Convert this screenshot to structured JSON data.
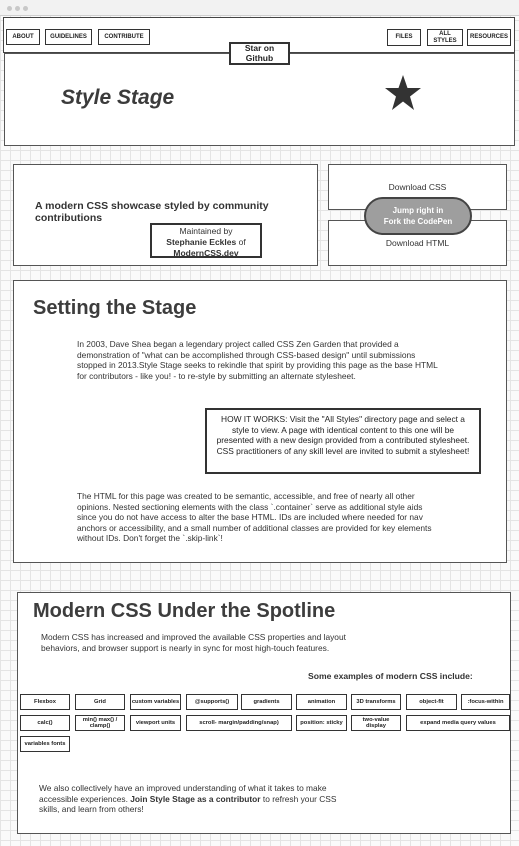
{
  "nav": {
    "about": "ABOUT",
    "guidelines": "GUIDELINES",
    "contribute": "CONTRIBUTE",
    "files": "FILES",
    "all_styles_line1": "ALL",
    "all_styles_line2": "STYLES",
    "resources": "RESOURCES"
  },
  "star_button": {
    "line1": "Star on",
    "line2": "Github"
  },
  "header": {
    "title": "Style Stage",
    "icon": "star-icon"
  },
  "intro": {
    "tagline": "A modern CSS showcase styled by community contributions",
    "maintained_by": "Maintained by",
    "author": "Stephanie Eckles",
    "of": "of",
    "site": "ModernCSS.dev"
  },
  "downloads": {
    "css": "Download CSS",
    "codepen_line1": "Jump right in",
    "codepen_line2": "Fork the CodePen",
    "html": "Download HTML"
  },
  "stage": {
    "title": "Setting the Stage",
    "p1": "In 2003, Dave Shea began a legendary project called CSS Zen Garden that provided a demonstration of \"what can be accomplished through CSS-based design\" until submissions stopped in 2013.Style Stage seeks to rekindle that spirit by providing this page as the base HTML for contributors - like you! - to re-style by submitting an alternate stylesheet.",
    "howto": "HOW IT WORKS: Visit the \"All Styles\" directory page and select a style to view. A page with identical content to this one will be presented with a new design provided from a contributed stylesheet. CSS practitioners of any skill level are invited to submit a stylesheet!",
    "p2": "The HTML for this page was created to be semantic, accessible, and free of nearly all other opinions. Nested sectioning elements with the class `.container` serve as additional style aids since you do not have access to alter the base HTML. IDs are included where needed for nav anchors or accessibility, and a small number of additional classes are provided for key elements without IDs. Don't forget the `.skip-link`!"
  },
  "modern": {
    "title": "Modern CSS Under the Spotline",
    "intro": "Modern CSS has increased and improved the available CSS properties and layout behaviors, and browser support is nearly in sync for most high-touch features.",
    "examples_heading": "Some examples of modern CSS include:",
    "features": [
      "Flexbox",
      "Grid",
      "custom variables",
      "@supports()",
      "gradients",
      "animation",
      "3D transforms",
      "object-fit",
      ":focus-within",
      "calc()",
      "min() max() / clamp()",
      "viewport units",
      "scroll- margin/padding/snap)",
      "position: sticky",
      "two-value display",
      "expand media query values",
      "variables fonts"
    ],
    "outro_pre": "We also collectively have an improved understanding of what it takes to make accessible experiences. ",
    "outro_bold": "Join Style Stage as a contributor",
    "outro_post": " to refresh your CSS skills, and learn from others!"
  }
}
